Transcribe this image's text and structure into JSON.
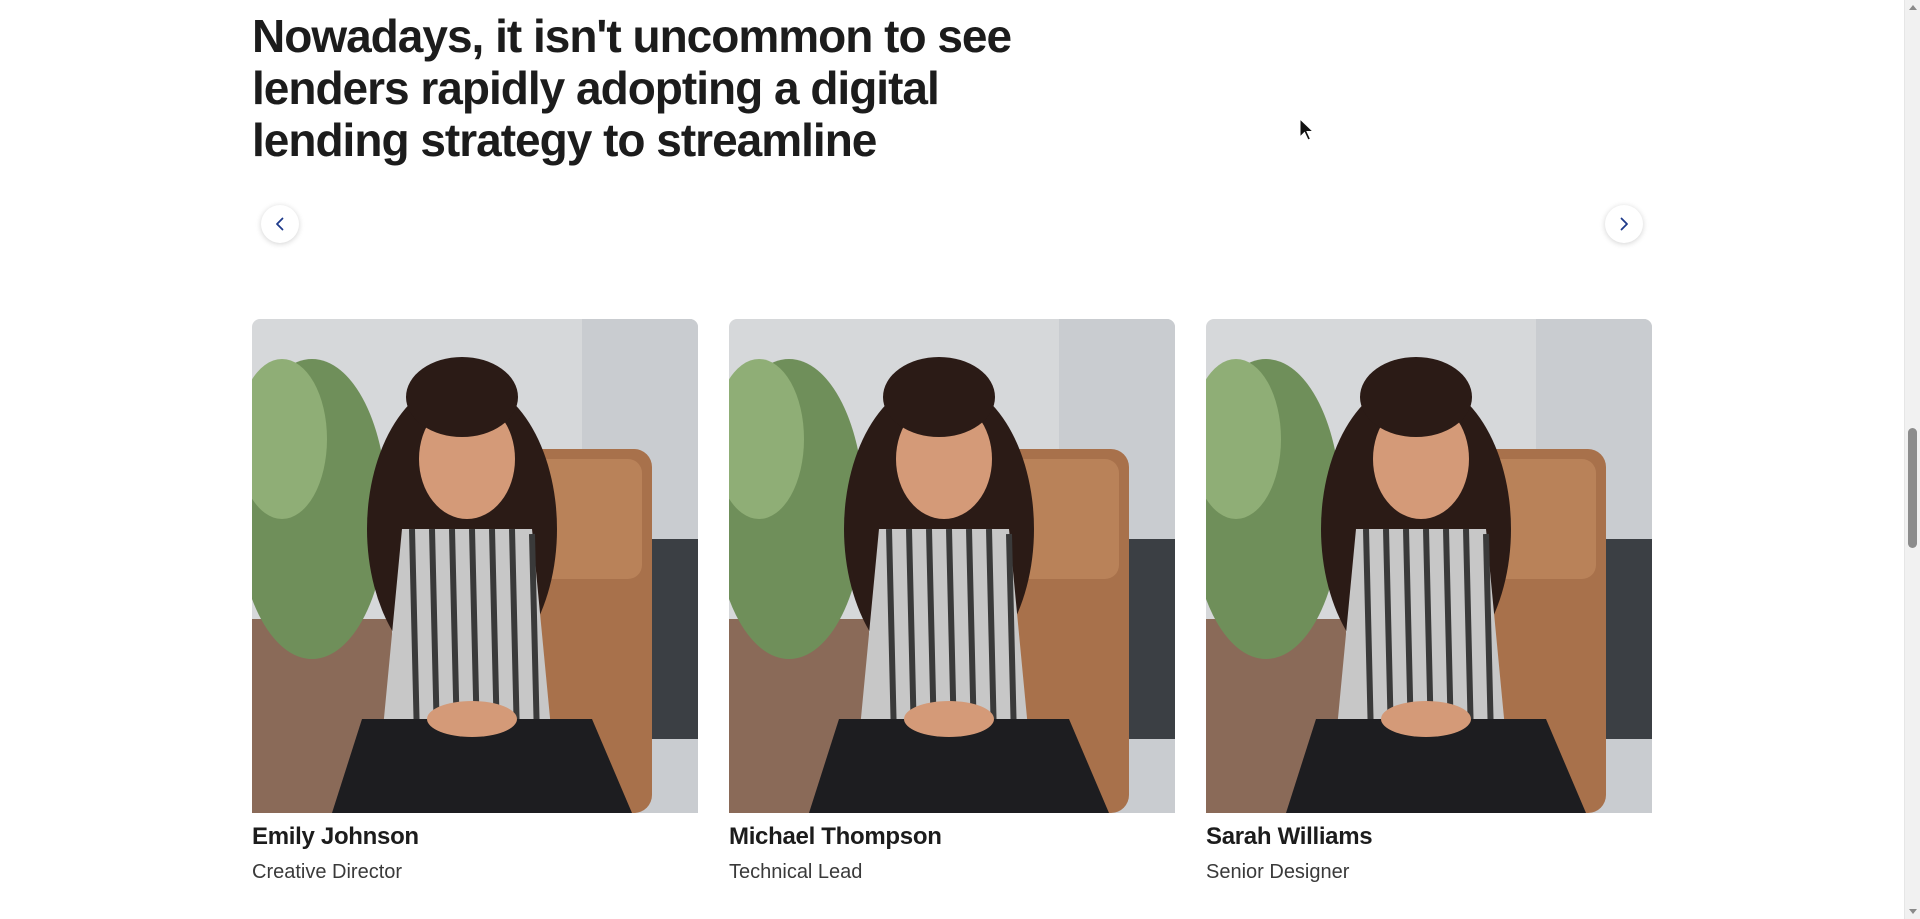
{
  "hero": {
    "headline": "Nowadays, it isn't uncommon to see lenders rapidly adopting a digital lending strategy to streamline"
  },
  "carousel": {
    "prev_icon": "chevron-left-icon",
    "next_icon": "chevron-right-icon",
    "accent_color": "#1e3a8a"
  },
  "team": [
    {
      "name": "Emily Johnson",
      "role": "Creative Director"
    },
    {
      "name": "Michael Thompson",
      "role": "Technical Lead"
    },
    {
      "name": "Sarah Williams",
      "role": "Senior Designer"
    }
  ]
}
